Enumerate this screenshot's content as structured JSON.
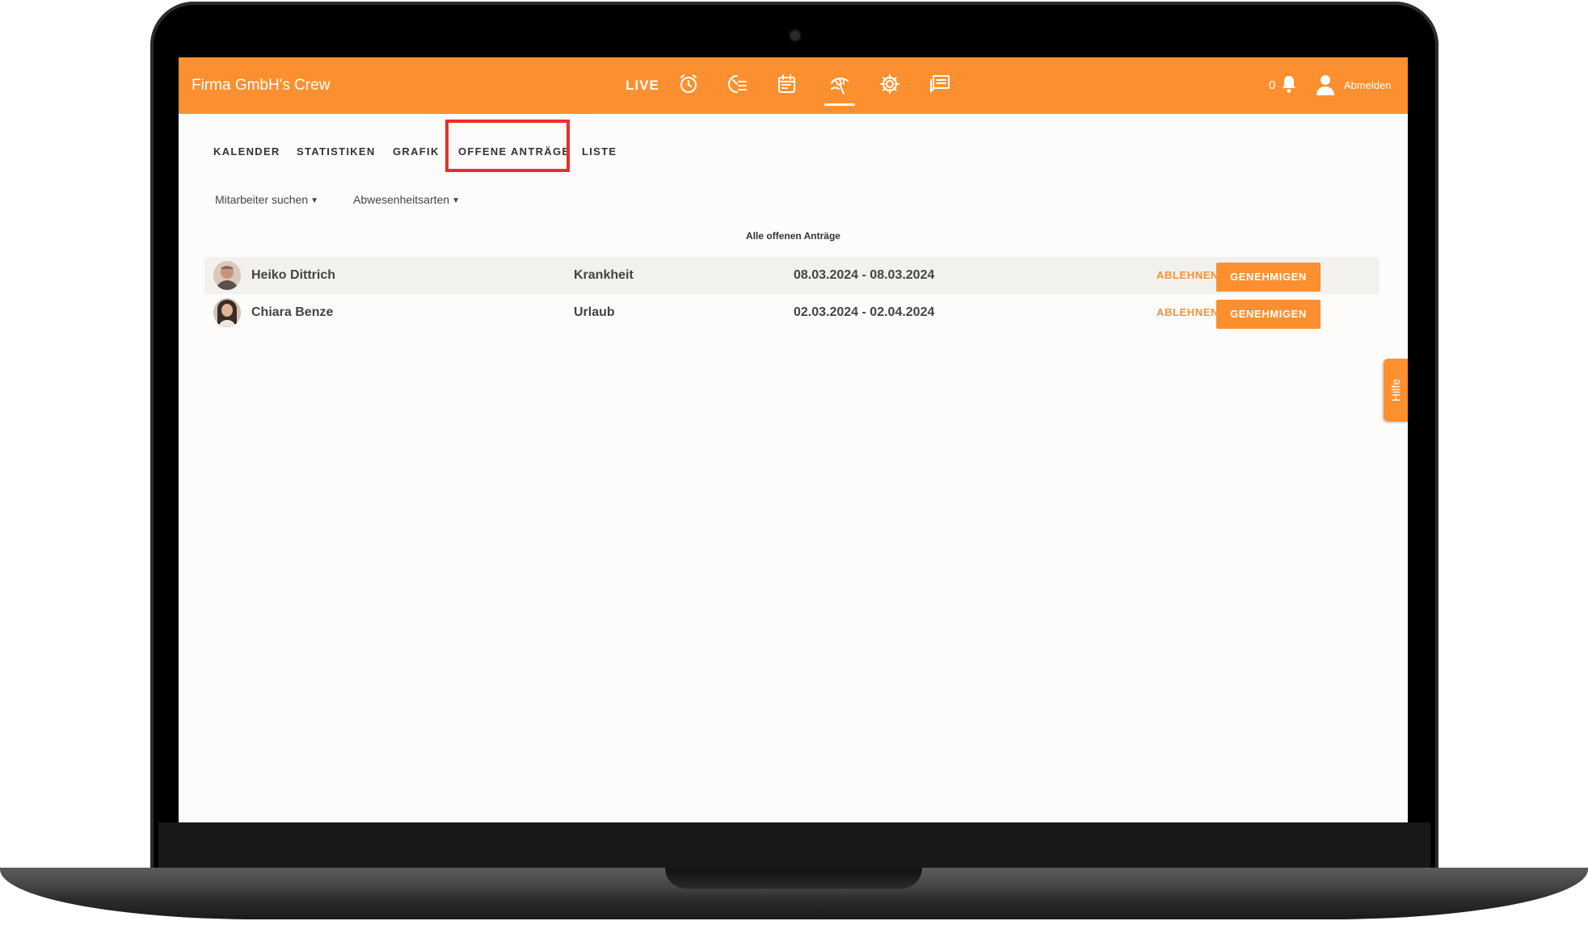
{
  "app": {
    "brand": "Firma GmbH's Crew"
  },
  "topnav": {
    "live_label": "LIVE",
    "icons": [
      "alarm-clock-icon",
      "time-list-icon",
      "calendar-icon",
      "vacation-icon",
      "gear-icon",
      "chat-icon"
    ],
    "active_icon": "vacation-icon",
    "notification_count": "0",
    "logout_label": "Abmelden"
  },
  "tabs": {
    "items": [
      "KALENDER",
      "STATISTIKEN",
      "GRAFIK",
      "OFFENE ANTRÄGE",
      "LISTE"
    ],
    "active": "OFFENE ANTRÄGE"
  },
  "filters": {
    "employee": "Mitarbeiter suchen",
    "absence_types": "Abwesenheitsarten"
  },
  "list": {
    "title": "Alle offenen Anträge",
    "rows": [
      {
        "name": "Heiko Dittrich",
        "type": "Krankheit",
        "period": "08.03.2024 - 08.03.2024",
        "reject": "ABLEHNEN",
        "approve": "GENEHMIGEN"
      },
      {
        "name": "Chiara Benze",
        "type": "Urlaub",
        "period": "02.03.2024 - 02.04.2024",
        "reject": "ABLEHNEN",
        "approve": "GENEHMIGEN"
      }
    ]
  },
  "help": {
    "label": "Hilfe"
  },
  "colors": {
    "accent": "#fc9030",
    "highlight": "#e8302a",
    "text": "#444444"
  }
}
